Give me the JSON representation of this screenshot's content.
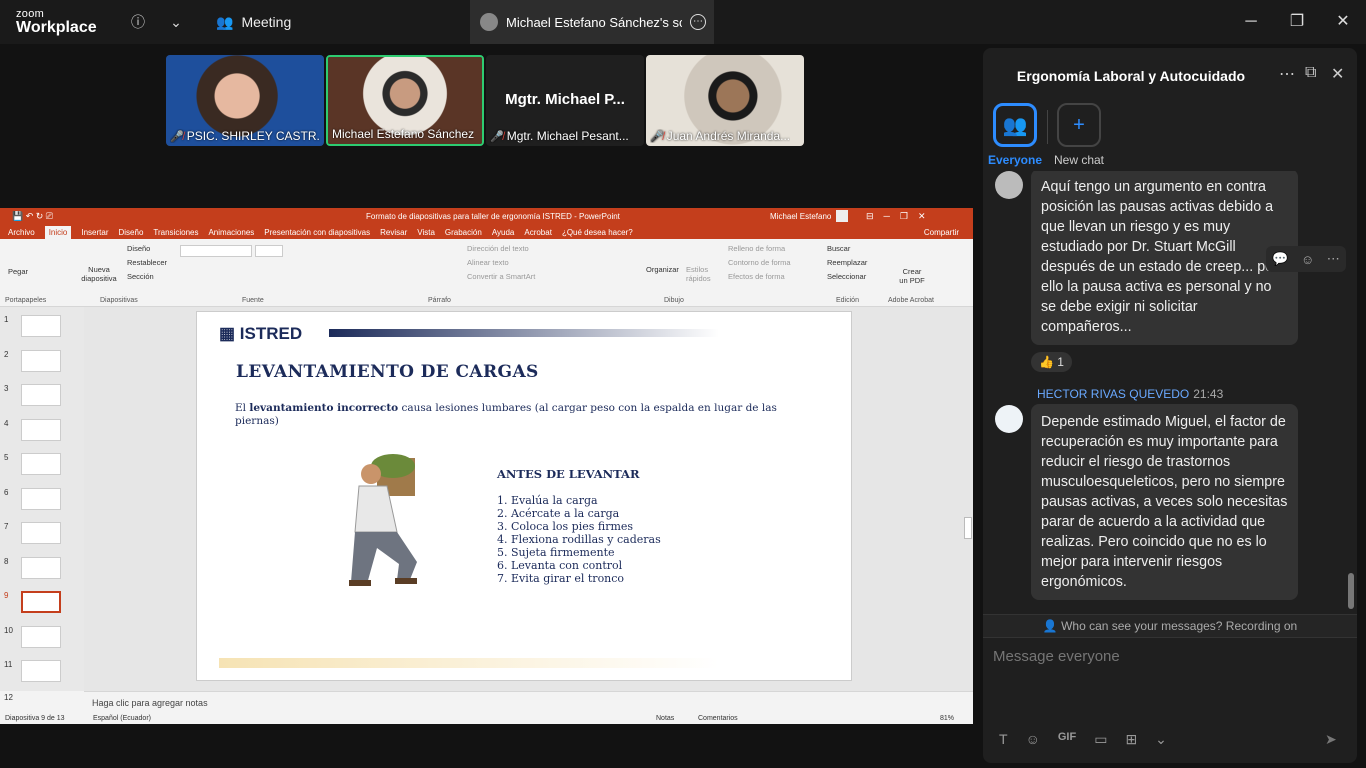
{
  "app": {
    "brand_line1": "zoom",
    "brand_line2": "Workplace"
  },
  "tabs": {
    "meeting_label": "Meeting",
    "share_label": "Michael Estefano Sánchez's scree"
  },
  "participants": [
    {
      "name": "PSIC. SHIRLEY CASTR...",
      "muted": true
    },
    {
      "name": "Michael Estefano Sánchez",
      "muted": false
    },
    {
      "name": "Mgtr. Michael Pesant...",
      "display": "Mgtr. Michael P...",
      "muted": true
    },
    {
      "name": "Juan Andrés Miranda...",
      "muted": true
    }
  ],
  "ppt": {
    "window_title": "Formato de diapositivas para taller de ergonomía ISTRED  -  PowerPoint",
    "user": "Michael Estefano",
    "tabs": [
      "Archivo",
      "Inicio",
      "Insertar",
      "Diseño",
      "Transiciones",
      "Animaciones",
      "Presentación con diapositivas",
      "Revisar",
      "Vista",
      "Grabación",
      "Ayuda",
      "Acrobat",
      "¿Qué desea hacer?"
    ],
    "share": "Compartir",
    "groups": {
      "portapapeles": "Portapapeles",
      "diapositivas": "Diapositivas",
      "fuente": "Fuente",
      "parrafo": "Párrafo",
      "dibujo": "Dibujo",
      "edicion": "Edición",
      "acrobat": "Adobe Acrobat"
    },
    "buttons": {
      "pegar": "Pegar",
      "nueva": "Nueva diapositiva",
      "diseno": "Diseño",
      "restablecer": "Restablecer",
      "seccion": "Sección",
      "direccion": "Dirección del texto",
      "alinear": "Alinear texto",
      "smartart": "Convertir a SmartArt",
      "organizar": "Organizar",
      "estilos": "Estilos rápidos",
      "relleno": "Relleno de forma",
      "contorno": "Contorno de forma",
      "efectos": "Efectos de forma",
      "buscar": "Buscar",
      "reemplazar": "Reemplazar",
      "seleccionar": "Seleccionar",
      "pdf": "Crear un PDF"
    },
    "slide_numbers": [
      "1",
      "2",
      "3",
      "4",
      "5",
      "6",
      "7",
      "8",
      "9",
      "10",
      "11",
      "12"
    ],
    "selected_slide": 9,
    "slide": {
      "logo": "ISTRED",
      "title": "LEVANTAMIENTO DE CARGAS",
      "intro_pre": "El ",
      "intro_bold": "levantamiento incorrecto",
      "intro_post": " causa lesiones lumbares (al cargar peso con la espalda en lugar de las piernas)",
      "subtitle": "ANTES DE LEVANTAR",
      "steps": [
        "1. Evalúa la carga",
        "2. Acércate a la carga",
        "3. Coloca los pies firmes",
        "4. Flexiona rodillas y caderas",
        "5. Sujeta firmemente",
        "6. Levanta con control",
        "7. Evita girar el tronco"
      ]
    },
    "notes_placeholder": "Haga clic para agregar notas",
    "status": {
      "slide_count": "Diapositiva 9 de 13",
      "language": "Español (Ecuador)",
      "notas": "Notas",
      "comentarios": "Comentarios",
      "zoom": "81%"
    }
  },
  "chat": {
    "title": "Ergonomía Laboral y Autocuidado",
    "audiences": [
      {
        "label": "Everyone",
        "selected": true
      },
      {
        "label": "New chat",
        "selected": false
      }
    ],
    "messages": [
      {
        "sender": "",
        "time": "",
        "text": "Aquí tengo un argumento en contra posición las pausas activas debido a que llevan un riesgo y es muy estudiado por Dr. Stuart McGill después de un estado de creep... por ello  la pausa activa es personal y no se debe exigir ni solicitar compañeros...",
        "reaction": "👍 1"
      },
      {
        "sender": "HECTOR RIVAS QUEVEDO",
        "time": "21:43",
        "text": "Depende estimado Miguel, el factor de recuperación es muy importante para reducir el riesgo de trastornos musculoesqueleticos, pero no siempre pausas activas, a veces solo necesitas parar de acuerdo a la actividad que realizas. Pero coincido que no es lo mejor para intervenir riesgos ergonómicos."
      }
    ],
    "visibility_note": "Who can see your messages? Recording on",
    "input_placeholder": "Message everyone",
    "gif_label": "GIF"
  },
  "colors": {
    "ppt_red": "#c43e1c",
    "zoom_blue": "#2d8cff",
    "active_green": "#2ecc71"
  }
}
